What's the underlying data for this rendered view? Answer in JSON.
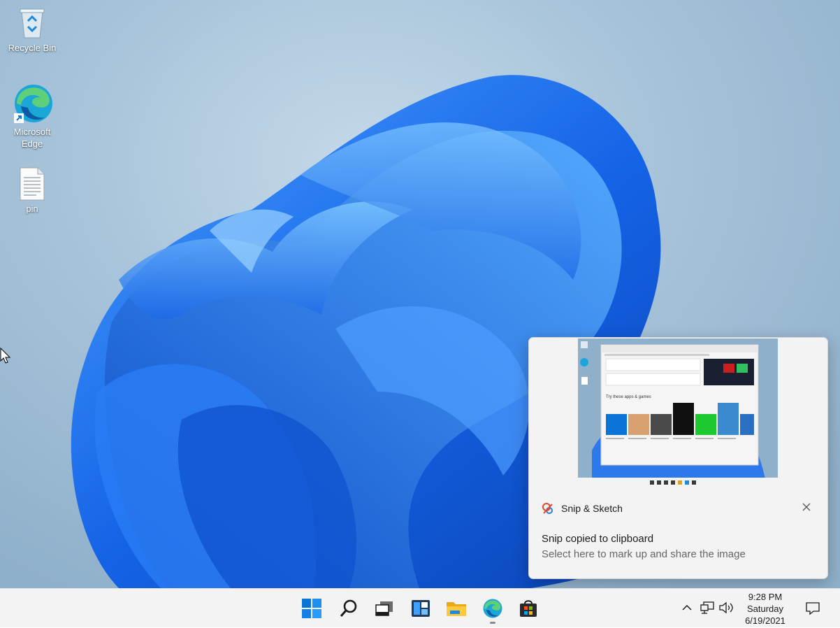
{
  "desktop": {
    "icons": [
      {
        "label": "Recycle Bin",
        "icon": "recycle-bin-icon"
      },
      {
        "label": "Microsoft Edge",
        "icon": "edge-icon"
      },
      {
        "label": "pin",
        "icon": "text-file-icon"
      }
    ]
  },
  "toast": {
    "app_name": "Snip & Sketch",
    "app_icon": "snip-sketch-icon",
    "title": "Snip copied to clipboard",
    "subtitle": "Select here to mark up and share the image",
    "thumb_section_title": "Try these apps & games",
    "close_icon": "close-icon"
  },
  "taskbar": {
    "apps": [
      "start-icon",
      "search-icon",
      "task-view-icon",
      "widgets-icon",
      "file-explorer-icon",
      "edge-icon",
      "store-icon"
    ],
    "tray": [
      "chevron-up-icon",
      "network-icon",
      "volume-icon"
    ],
    "clock": {
      "time": "9:28 PM",
      "day": "Saturday",
      "date": "6/19/2021"
    },
    "notification_icon": "notification-icon"
  },
  "colors": {
    "accent": "#0067c0",
    "bloom_blue": "#1f6ff0",
    "taskbar_bg": "#f3f3f3"
  }
}
